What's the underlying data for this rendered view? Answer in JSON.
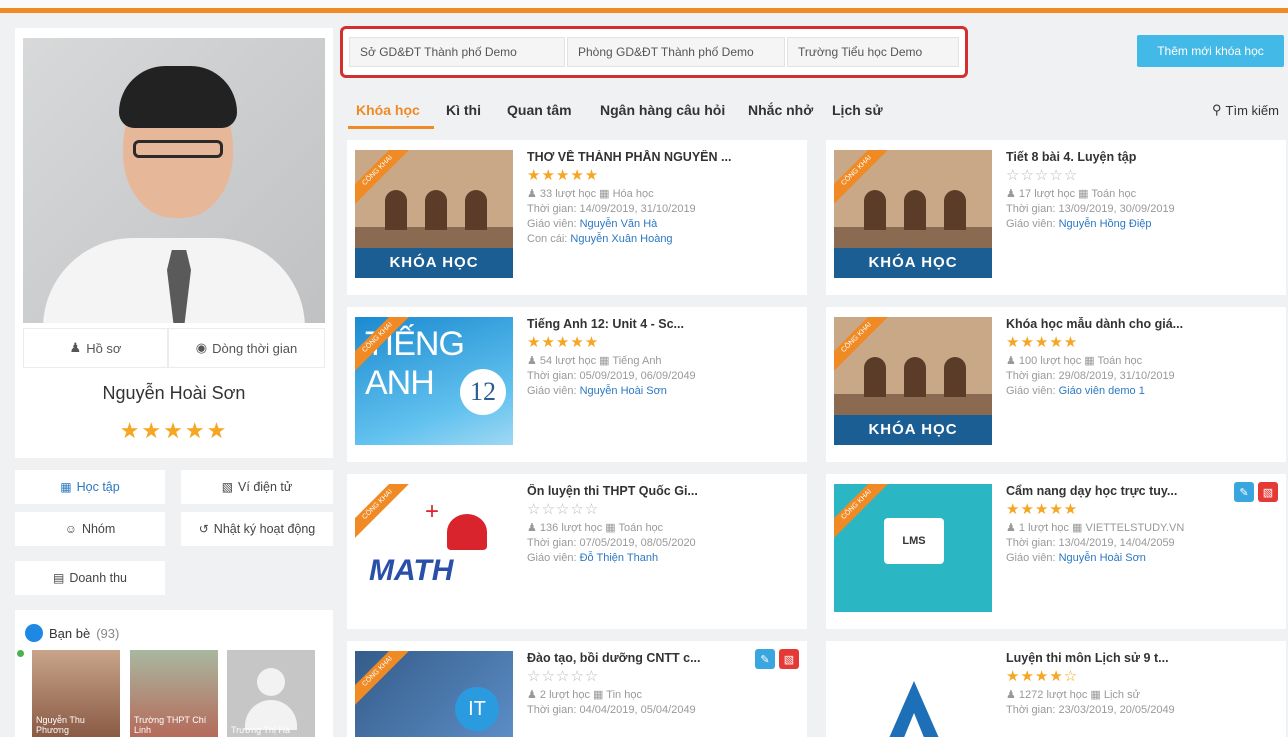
{
  "colors": {
    "accent": "#f08a24",
    "link": "#2b78c2",
    "primary_button": "#42b9e6",
    "star": "#f5a623",
    "highlight_border": "#d32f2f"
  },
  "profile": {
    "tab_profile": "Hồ sơ",
    "tab_timeline": "Dòng thời gian",
    "name": "Nguyễn Hoài Sơn",
    "stars": "★★★★★"
  },
  "menu": {
    "study": "Học tập",
    "wallet": "Ví điện tử",
    "group": "Nhóm",
    "activity_log": "Nhật ký hoạt động",
    "revenue": "Doanh thu"
  },
  "friends": {
    "label": "Bạn bè",
    "count": "(93)",
    "items": [
      {
        "caption": "Nguyễn Thu Phương"
      },
      {
        "caption": "Trường THPT Chí Linh"
      },
      {
        "caption": "Trương Thị Hà"
      }
    ]
  },
  "breadcrumb": [
    "Sở GD&ĐT Thành phố Demo",
    "Phòng GD&ĐT Thành phố Demo",
    "Trường Tiểu học Demo"
  ],
  "add_course_button": "Thêm mới khóa học",
  "tabs": [
    "Khóa học",
    "Kì thi",
    "Quan tâm",
    "Ngân hàng câu hỏi",
    "Nhắc nhở",
    "Lịch sử"
  ],
  "search_label": "Tìm kiếm",
  "thumb_texts": {
    "khoa_hoc": "KHÓA HỌC",
    "ribbon": "CÔNG KHAI",
    "tieng_anh": "TIẾNG ANH",
    "twelve": "12",
    "math": "MATH",
    "lms": "LMS",
    "it": "IT"
  },
  "courses": [
    {
      "title": "THƠ VỀ THÀNH PHẦN NGUYÊN ...",
      "stars": "★★★★★",
      "stars_filled": true,
      "learns": "33 lượt học",
      "subject": "Hóa học",
      "time": "Thời gian: 14/09/2019, 31/10/2019",
      "teacher_label": "Giáo viên: ",
      "teacher": "Nguyễn Văn Hà",
      "extra_label": "Con cái: ",
      "extra": "Nguyễn Xuân Hoàng"
    },
    {
      "title": "Tiết 8 bài 4. Luyện tập",
      "stars": "☆☆☆☆☆",
      "stars_filled": false,
      "learns": "17 lượt học",
      "subject": "Toán học",
      "time": "Thời gian: 13/09/2019, 30/09/2019",
      "teacher_label": "Giáo viên: ",
      "teacher": "Nguyễn Hồng Điệp"
    },
    {
      "title": "Tiếng Anh 12: Unit 4 - Sc...",
      "stars": "★★★★★",
      "stars_filled": true,
      "learns": "54 lượt học",
      "subject": "Tiếng Anh",
      "time": "Thời gian: 05/09/2019, 06/09/2049",
      "teacher_label": "Giáo viên: ",
      "teacher": "Nguyễn Hoài Sơn"
    },
    {
      "title": "Khóa học mẫu dành cho giá...",
      "stars": "★★★★★",
      "stars_filled": true,
      "learns": "100 lượt học",
      "subject": "Toán học",
      "time": "Thời gian: 29/08/2019, 31/10/2019",
      "teacher_label": "Giáo viên: ",
      "teacher": "Giáo viên demo 1"
    },
    {
      "title": "Ôn luyện thi THPT Quốc Gi...",
      "stars": "☆☆☆☆☆",
      "stars_filled": false,
      "learns": "136 lượt học",
      "subject": "Toán học",
      "time": "Thời gian: 07/05/2019, 08/05/2020",
      "teacher_label": "Giáo viên: ",
      "teacher": "Đỗ Thiện Thanh"
    },
    {
      "title": "Cẩm nang dạy học trực tuy...",
      "stars": "★★★★★",
      "stars_filled": true,
      "learns": "1 lượt học",
      "subject": "VIETTELSTUDY.VN",
      "time": "Thời gian: 13/04/2019, 14/04/2059",
      "teacher_label": "Giáo viên: ",
      "teacher": "Nguyễn Hoài Sơn"
    },
    {
      "title": "Đào tạo, bồi dưỡng CNTT c...",
      "stars": "☆☆☆☆☆",
      "stars_filled": false,
      "learns": "2 lượt học",
      "subject": "Tin học",
      "time": "Thời gian: 04/04/2019, 05/04/2049",
      "teacher_label": "",
      "teacher": ""
    },
    {
      "title": "Luyện thi môn Lịch sử 9 t...",
      "stars": "★★★★☆",
      "stars_filled": true,
      "learns": "1272 lượt học",
      "subject": "Lịch sử",
      "time": "Thời gian: 23/03/2019, 20/05/2049",
      "teacher_label": "",
      "teacher": ""
    }
  ]
}
